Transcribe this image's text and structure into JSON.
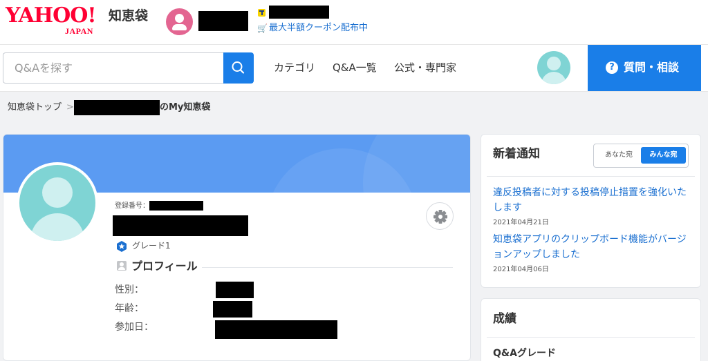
{
  "header": {
    "logo_main": "YAHOO!",
    "logo_sub": "JAPAN",
    "service_name": "知恵袋",
    "coupon_text": "最大半額クーポン配布中",
    "icons": {
      "avatar": "user-avatar-icon",
      "tpoint": "tpoint-icon",
      "cart": "cart-icon"
    }
  },
  "nav": {
    "search_placeholder": "Q&Aを探す",
    "links": [
      "カテゴリ",
      "Q&A一覧",
      "公式・専門家"
    ],
    "ask_button": "質問・相談",
    "ask_icon": "?"
  },
  "breadcrumb": {
    "home": "知恵袋トップ",
    "separator": ">",
    "current_suffix": "のMy知恵袋"
  },
  "profile": {
    "regno_label": "登録番号：",
    "grade": "グレード1",
    "section_title": "プロフィール",
    "fields": [
      "性別：",
      "年齢：",
      "参加日："
    ]
  },
  "notice": {
    "title": "新着通知",
    "tab_you": "あなた宛",
    "tab_all": "みんな宛",
    "items": [
      {
        "text": "違反投稿者に対する投稿停止措置を強化いたします",
        "date": "2021年04月21日"
      },
      {
        "text": "知恵袋アプリのクリップボード機能がバージョンアップしました",
        "date": "2021年04月06日"
      }
    ]
  },
  "stats": {
    "title": "成績",
    "grade_heading": "Q&Aグレード"
  },
  "colors": {
    "brand_red": "#ff0033",
    "accent_blue": "#1a7ee8",
    "banner_blue": "#5b9bf2",
    "link_blue": "#1a6fd0",
    "avatar_pink": "#e36591",
    "avatar_teal": "#7fd4d4"
  }
}
